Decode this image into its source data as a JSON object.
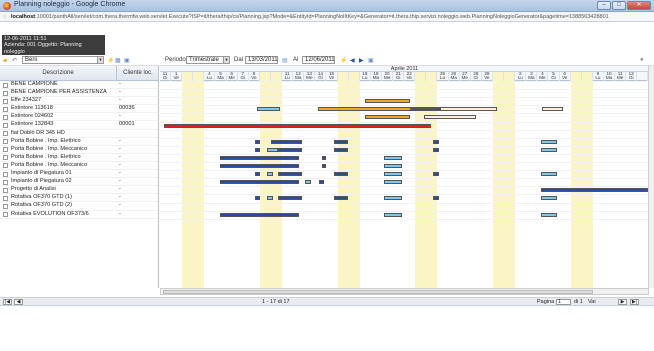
{
  "window": {
    "title": "Planning noleggio - Google Chrome",
    "host": "localhost",
    "url_rest": ":10001/panthAll/servlet/com.thera.thermfw.web.servlet.Execute?ISP=it/thera/thip/cs/Planning.jsp?Mode=&EntityId=PlanningNolItKey=&Generator=it.thera.thip.servizi.noleggio.web.PlanningNoleggioGenerator&pagetime=1388563428801",
    "min": "–",
    "max": "□",
    "close": "✕"
  },
  "info": {
    "line1": "12-06-2011 11:51",
    "line2": "Azienda: 001  Oggetto: Planning noleggio"
  },
  "toolbar": {
    "resource": "Beni",
    "periodo_label": "Periodo",
    "periodo": "Trimestrale",
    "dal_label": "Dal",
    "dal": "13/03/2011",
    "al_label": "Al",
    "al": "12/06/2011"
  },
  "columns": {
    "desc": "Descrizione",
    "client": "Cliente loc."
  },
  "month": "Aprile 2011",
  "days": [
    {
      "n": "11",
      "w": "Gi",
      "we": false
    },
    {
      "n": "1",
      "w": "Ve",
      "we": false
    },
    {
      "n": "",
      "w": "",
      "we": true
    },
    {
      "n": "",
      "w": "",
      "we": true
    },
    {
      "n": "4",
      "w": "Lu",
      "we": false
    },
    {
      "n": "5",
      "w": "Ma",
      "we": false
    },
    {
      "n": "6",
      "w": "Me",
      "we": false
    },
    {
      "n": "7",
      "w": "Gi",
      "we": false
    },
    {
      "n": "8",
      "w": "Ve",
      "we": false
    },
    {
      "n": "",
      "w": "",
      "we": true
    },
    {
      "n": "",
      "w": "",
      "we": true
    },
    {
      "n": "11",
      "w": "Lu",
      "we": false
    },
    {
      "n": "12",
      "w": "Ma",
      "we": false
    },
    {
      "n": "13",
      "w": "Me",
      "we": false
    },
    {
      "n": "14",
      "w": "Gi",
      "we": false
    },
    {
      "n": "15",
      "w": "Ve",
      "we": false
    },
    {
      "n": "",
      "w": "",
      "we": true
    },
    {
      "n": "",
      "w": "",
      "we": true
    },
    {
      "n": "18",
      "w": "Lu",
      "we": false
    },
    {
      "n": "19",
      "w": "Ma",
      "we": false
    },
    {
      "n": "20",
      "w": "Me",
      "we": false
    },
    {
      "n": "21",
      "w": "Gi",
      "we": false
    },
    {
      "n": "22",
      "w": "Ve",
      "we": false
    },
    {
      "n": "",
      "w": "",
      "we": true
    },
    {
      "n": "",
      "w": "",
      "we": true
    },
    {
      "n": "25",
      "w": "Lu",
      "we": false
    },
    {
      "n": "26",
      "w": "Ma",
      "we": false
    },
    {
      "n": "27",
      "w": "Me",
      "we": false
    },
    {
      "n": "28",
      "w": "Gi",
      "we": false
    },
    {
      "n": "29",
      "w": "Ve",
      "we": false
    },
    {
      "n": "",
      "w": "",
      "we": true
    },
    {
      "n": "",
      "w": "",
      "we": true
    },
    {
      "n": "2",
      "w": "Lu",
      "we": false
    },
    {
      "n": "3",
      "w": "Ma",
      "we": false
    },
    {
      "n": "4",
      "w": "Me",
      "we": false
    },
    {
      "n": "5",
      "w": "Gi",
      "we": false
    },
    {
      "n": "6",
      "w": "Ve",
      "we": false
    },
    {
      "n": "",
      "w": "",
      "we": true
    },
    {
      "n": "",
      "w": "",
      "we": true
    },
    {
      "n": "9",
      "w": "Lu",
      "we": false
    },
    {
      "n": "10",
      "w": "Ma",
      "we": false
    },
    {
      "n": "11",
      "w": "Me",
      "we": false
    },
    {
      "n": "12",
      "w": "Gi",
      "we": false
    },
    {
      "n": "",
      "w": "",
      "we": false
    }
  ],
  "rows": [
    {
      "d": "BENE CAMPIONE",
      "c": "-"
    },
    {
      "d": "BENE CAMPIONE PER ASSISTENZA",
      "c": "-"
    },
    {
      "d": "Effe 234327",
      "c": "-"
    },
    {
      "d": "Estintore 113618",
      "c": "00036"
    },
    {
      "d": "Estintore 024602",
      "c": "-"
    },
    {
      "d": "Estintore 132843",
      "c": "00001"
    },
    {
      "d": "fiat Doblò DR 345 HD",
      "c": ""
    },
    {
      "d": "Porta Bobine . Imp. Elettrico",
      "c": "-"
    },
    {
      "d": "Porta Bobine . Imp. Meccanico",
      "c": "-"
    },
    {
      "d": "Porta Bobine . Imp. Elettrico",
      "c": "-"
    },
    {
      "d": "Porta Bobine . Imp. Meccanico",
      "c": "-"
    },
    {
      "d": "Impianto di Piegatura 01",
      "c": "-"
    },
    {
      "d": "Impianto di Piegatura 02",
      "c": "-"
    },
    {
      "d": "Progetto di Analisi",
      "c": "-"
    },
    {
      "d": "Rotativa OF370 GTD (1)",
      "c": "-"
    },
    {
      "d": "Rotativa OF370 GTD (2)",
      "c": "-"
    },
    {
      "d": "Rotativa EVOLUTION OF373/6",
      "c": "-"
    }
  ],
  "colors": {
    "orange": "#f5a623",
    "lightblue": "#7ec8ee",
    "darkblue": "#2a4aa6",
    "red": "#e02020",
    "grey": "#555555",
    "cream": "#fdf0dc",
    "weekend": "#fbf4c4"
  },
  "bars": [
    {
      "row": 2,
      "s": 18.5,
      "e": 22.5,
      "color": "orange"
    },
    {
      "row": 3,
      "s": 8.7,
      "e": 10.8,
      "color": "lightblue"
    },
    {
      "row": 3,
      "s": 14.2,
      "e": 22.6,
      "color": "orange"
    },
    {
      "row": 3,
      "s": 22.6,
      "e": 25.2,
      "color": "grey"
    },
    {
      "row": 3,
      "s": 25.2,
      "e": 30.4,
      "color": "cream"
    },
    {
      "row": 3,
      "s": 34.4,
      "e": 36.3,
      "color": "cream"
    },
    {
      "row": 4,
      "s": 18.5,
      "e": 22.5,
      "color": "orange"
    },
    {
      "row": 4,
      "s": 23.8,
      "e": 28.5,
      "color": "cream"
    },
    {
      "row": 5,
      "s": 0.4,
      "e": 24.4,
      "color": "red"
    },
    {
      "row": 7,
      "s": 8.6,
      "e": 9.0,
      "color": "darkblue"
    },
    {
      "row": 7,
      "s": 10.0,
      "e": 12.8,
      "color": "darkblue"
    },
    {
      "row": 7,
      "s": 15.7,
      "e": 16.9,
      "color": "darkblue"
    },
    {
      "row": 7,
      "s": 24.6,
      "e": 25.1,
      "color": "darkblue"
    },
    {
      "row": 7,
      "s": 34.3,
      "e": 35.8,
      "color": "lightblue"
    },
    {
      "row": 8,
      "s": 8.6,
      "e": 9.0,
      "color": "darkblue"
    },
    {
      "row": 8,
      "s": 9.6,
      "e": 10.6,
      "color": "lightblue"
    },
    {
      "row": 8,
      "s": 10.6,
      "e": 12.8,
      "color": "darkblue"
    },
    {
      "row": 8,
      "s": 15.7,
      "e": 16.9,
      "color": "darkblue"
    },
    {
      "row": 8,
      "s": 24.6,
      "e": 25.1,
      "color": "darkblue"
    },
    {
      "row": 8,
      "s": 34.3,
      "e": 35.8,
      "color": "lightblue"
    },
    {
      "row": 9,
      "s": 5.4,
      "e": 12.5,
      "color": "darkblue"
    },
    {
      "row": 9,
      "s": 14.6,
      "e": 15.0,
      "color": "darkblue"
    },
    {
      "row": 9,
      "s": 20.2,
      "e": 21.8,
      "color": "lightblue"
    },
    {
      "row": 10,
      "s": 5.4,
      "e": 12.5,
      "color": "darkblue"
    },
    {
      "row": 10,
      "s": 14.6,
      "e": 15.0,
      "color": "darkblue"
    },
    {
      "row": 10,
      "s": 20.2,
      "e": 21.8,
      "color": "lightblue"
    },
    {
      "row": 11,
      "s": 8.6,
      "e": 9.0,
      "color": "darkblue"
    },
    {
      "row": 11,
      "s": 9.6,
      "e": 10.2,
      "color": "lightblue"
    },
    {
      "row": 11,
      "s": 10.6,
      "e": 12.8,
      "color": "darkblue"
    },
    {
      "row": 11,
      "s": 15.7,
      "e": 16.9,
      "color": "darkblue"
    },
    {
      "row": 11,
      "s": 20.2,
      "e": 21.8,
      "color": "lightblue"
    },
    {
      "row": 11,
      "s": 24.6,
      "e": 25.1,
      "color": "darkblue"
    },
    {
      "row": 11,
      "s": 34.3,
      "e": 35.8,
      "color": "lightblue"
    },
    {
      "row": 12,
      "s": 5.4,
      "e": 12.5,
      "color": "darkblue"
    },
    {
      "row": 12,
      "s": 13.1,
      "e": 13.6,
      "color": "lightblue"
    },
    {
      "row": 12,
      "s": 14.3,
      "e": 14.8,
      "color": "darkblue"
    },
    {
      "row": 12,
      "s": 20.2,
      "e": 21.8,
      "color": "lightblue"
    },
    {
      "row": 13,
      "s": 34.3,
      "e": 44.0,
      "color": "darkblue"
    },
    {
      "row": 14,
      "s": 8.6,
      "e": 9.0,
      "color": "darkblue"
    },
    {
      "row": 14,
      "s": 9.6,
      "e": 10.2,
      "color": "lightblue"
    },
    {
      "row": 14,
      "s": 10.6,
      "e": 12.8,
      "color": "darkblue"
    },
    {
      "row": 14,
      "s": 15.7,
      "e": 16.9,
      "color": "darkblue"
    },
    {
      "row": 14,
      "s": 20.2,
      "e": 21.8,
      "color": "lightblue"
    },
    {
      "row": 14,
      "s": 24.6,
      "e": 25.1,
      "color": "darkblue"
    },
    {
      "row": 14,
      "s": 34.3,
      "e": 35.8,
      "color": "lightblue"
    },
    {
      "row": 16,
      "s": 5.4,
      "e": 12.5,
      "color": "darkblue"
    },
    {
      "row": 16,
      "s": 20.2,
      "e": 21.8,
      "color": "lightblue"
    },
    {
      "row": 16,
      "s": 34.3,
      "e": 35.8,
      "color": "lightblue"
    }
  ],
  "pager": {
    "range": "1 - 17 di 17",
    "pagina_label": "Pagina",
    "page": "1",
    "di": "di 1",
    "vai": "Vai"
  }
}
